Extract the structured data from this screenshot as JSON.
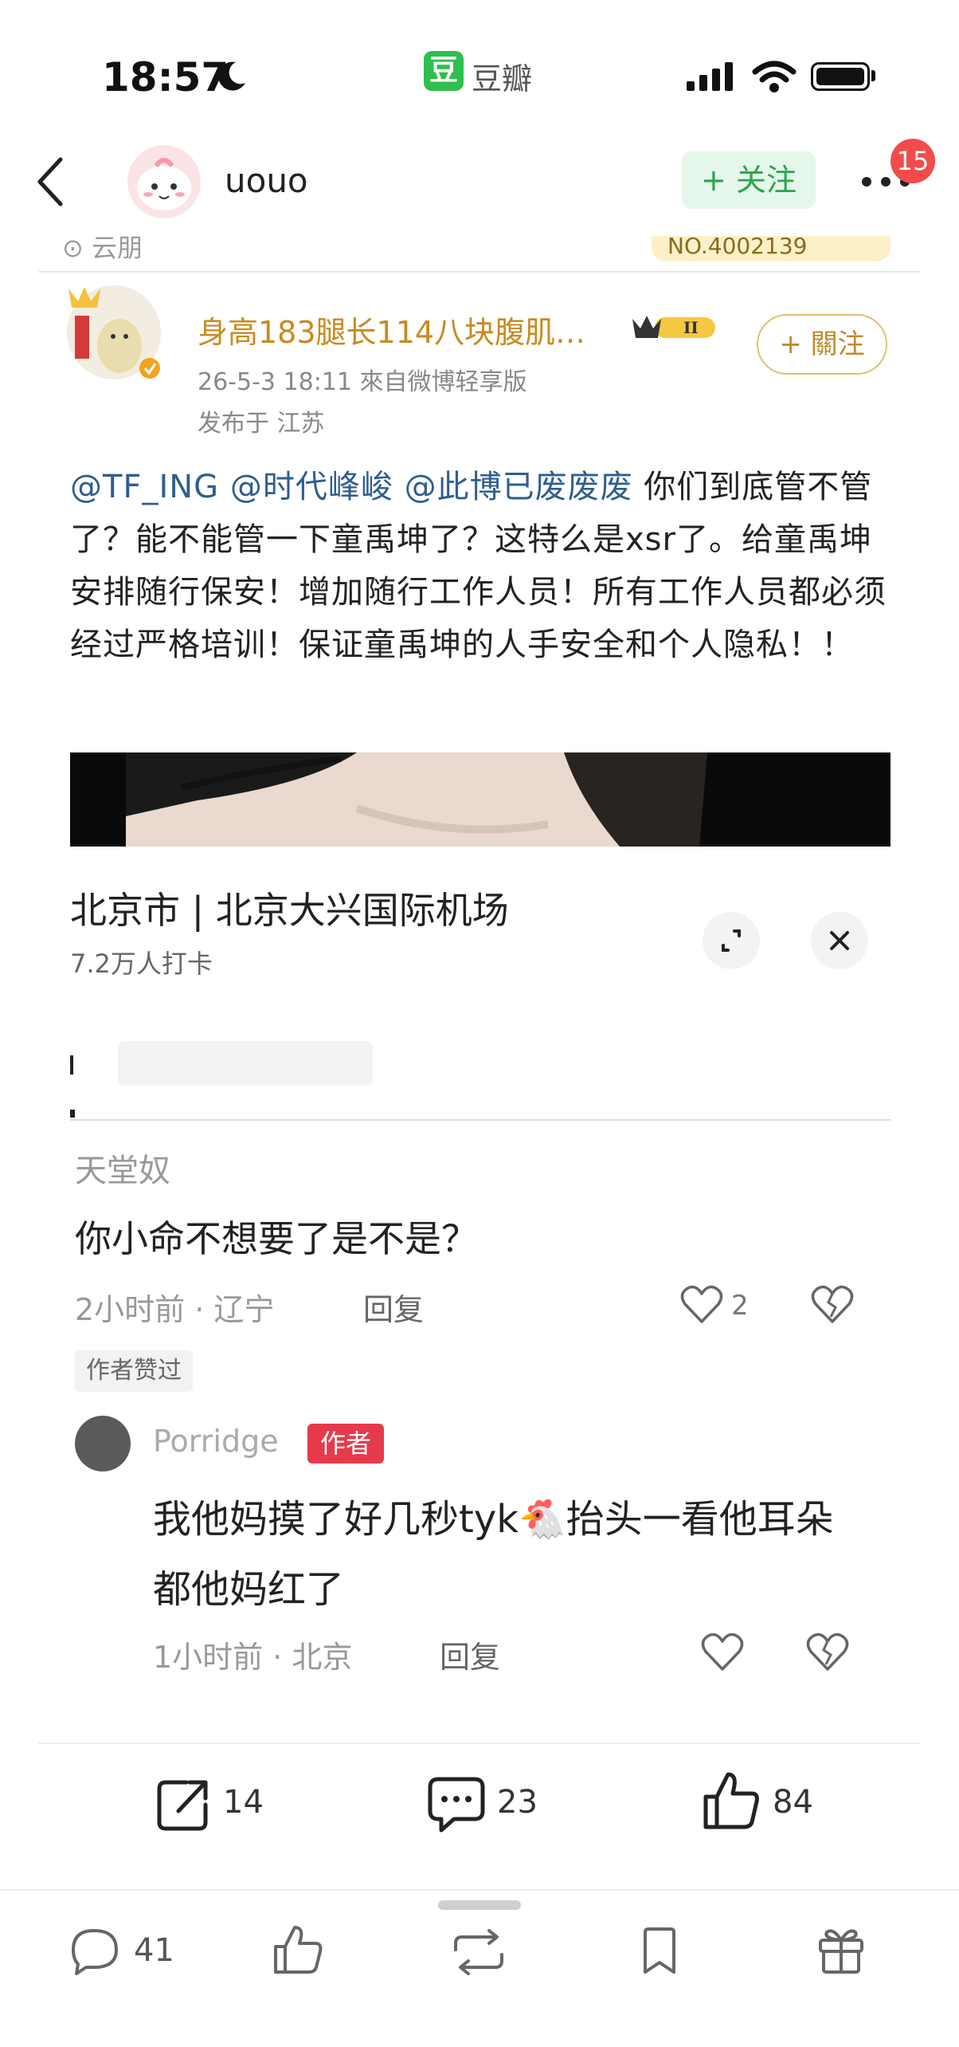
{
  "status_bar": {
    "time": "18:57",
    "app_name": "豆瓣",
    "app_logo_char": "豆"
  },
  "header": {
    "username": "uouo",
    "follow_label": "+ 关注",
    "notification_count": "15"
  },
  "post": {
    "top_cut": {
      "left_text": "⊙ 云朋",
      "right_text": "NO.4002139"
    },
    "weibo_user": {
      "name": "身高183腿长114八块腹肌…",
      "vip_level": "II",
      "meta": "26-5-3 18:11  來自微博轻享版",
      "location": "发布于 江苏",
      "follow_label": "+ 關注"
    },
    "text_segments": [
      {
        "text": "@TF_ING",
        "mention": true
      },
      {
        "text": " ",
        "mention": false
      },
      {
        "text": "@时代峰峻",
        "mention": true
      },
      {
        "text": " ",
        "mention": false
      },
      {
        "text": "@此博已废废废",
        "mention": true
      },
      {
        "text": " 你们到底管不管了？能不能管一下童禹坤了？这特么是xsr了。给童禹坤安排随行保安！增加随行工作人员！所有工作人员都必须经过严格培训！保证童禹坤的人手安全和个人隐私！！",
        "mention": false
      }
    ],
    "location_card": {
      "city_place": "北京市 | 北京大兴国际机场",
      "checkins": "7.2万人打卡"
    },
    "comments": [
      {
        "name": "天堂奴",
        "text": "你小命不想要了是不是？",
        "time": "2小时前 · 辽宁",
        "reply": "回复",
        "likes": "2",
        "badge": "作者赞过"
      },
      {
        "name": "Porridge",
        "author_tag": "作者",
        "text": "我他妈摸了好几秒tyk🐔抬头一看他耳朵都他妈红了",
        "time": "1小时前 · 北京",
        "reply": "回复"
      }
    ]
  },
  "actions": {
    "share_count": "14",
    "comment_count": "23",
    "like_count": "84"
  },
  "bottom_bar": {
    "comment_count": "41"
  },
  "colors": {
    "accent_green": "#2aa44f",
    "mention_blue": "#2f5e8f",
    "weibo_gold": "#c98a1e",
    "author_red": "#e63a4c",
    "badge_red": "#f24b4b"
  }
}
